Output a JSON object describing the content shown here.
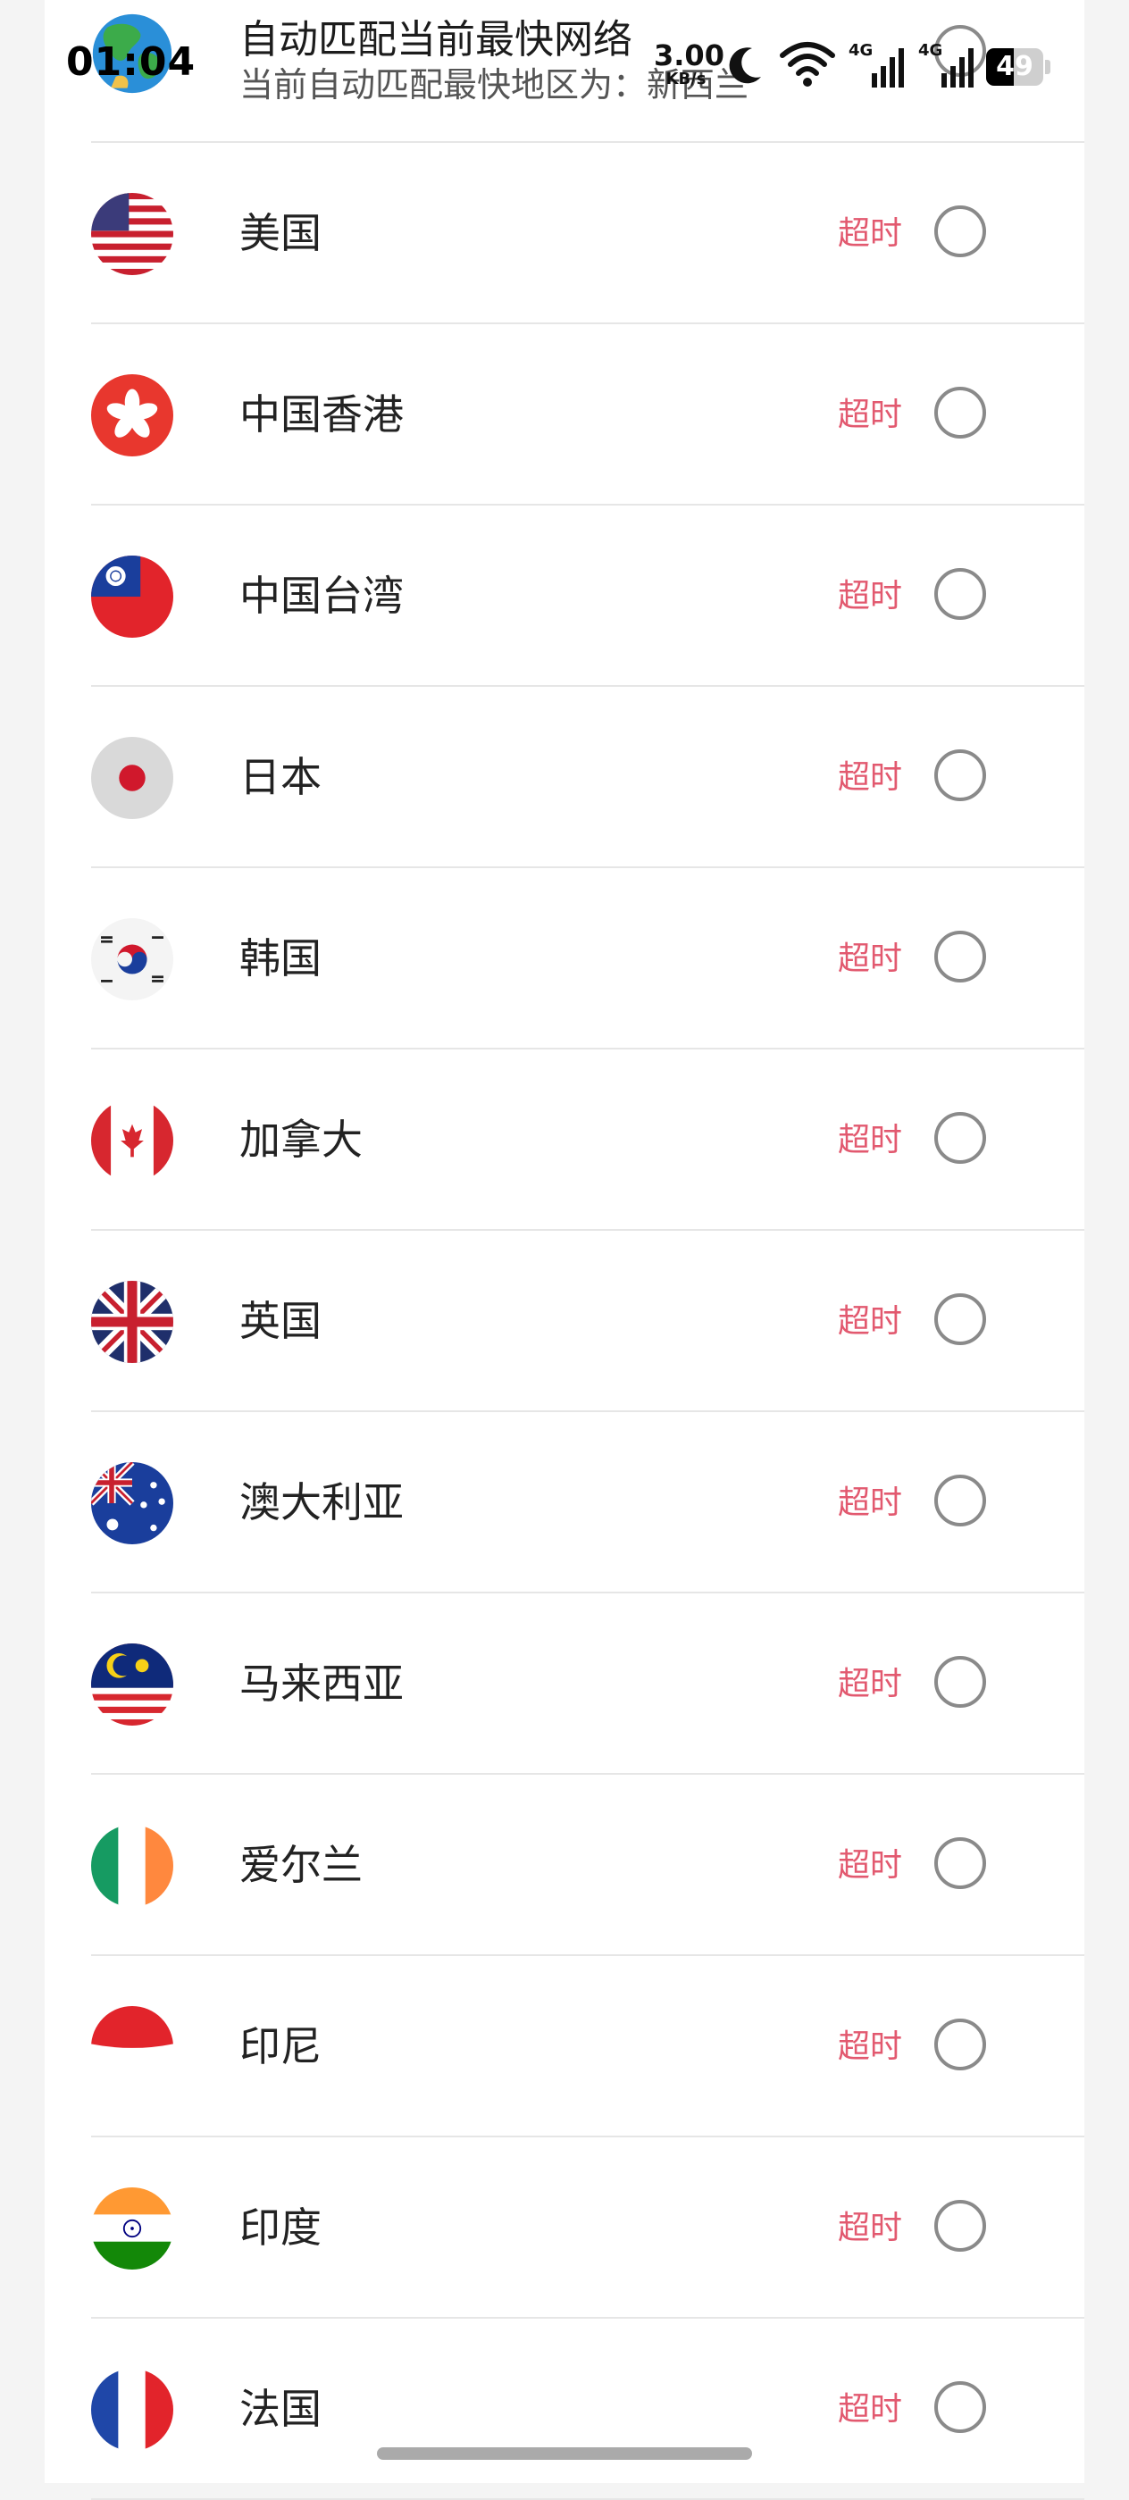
{
  "status_bar": {
    "time": "01:04",
    "net_speed_value": "3.00",
    "net_speed_unit": "KB/s",
    "network_1": "4G",
    "network_2": "4G",
    "battery_level": "49",
    "battery_fraction": 0.49
  },
  "auto_match": {
    "title": "自动匹配当前最快网络",
    "subtitle_prefix": "当前自动匹配最快地区为：",
    "subtitle_region": "新西兰"
  },
  "status_color": "#e2596f",
  "regions": [
    {
      "name": "美国",
      "status": "超时",
      "flag": "us-flag-icon"
    },
    {
      "name": "中国香港",
      "status": "超时",
      "flag": "hk-flag-icon"
    },
    {
      "name": "中国台湾",
      "status": "超时",
      "flag": "tw-flag-icon"
    },
    {
      "name": "日本",
      "status": "超时",
      "flag": "jp-flag-icon"
    },
    {
      "name": "韩国",
      "status": "超时",
      "flag": "kr-flag-icon"
    },
    {
      "name": "加拿大",
      "status": "超时",
      "flag": "ca-flag-icon"
    },
    {
      "name": "英国",
      "status": "超时",
      "flag": "uk-flag-icon"
    },
    {
      "name": "澳大利亚",
      "status": "超时",
      "flag": "au-flag-icon"
    },
    {
      "name": "马来西亚",
      "status": "超时",
      "flag": "my-flag-icon"
    },
    {
      "name": "爱尔兰",
      "status": "超时",
      "flag": "ie-flag-icon"
    },
    {
      "name": "印尼",
      "status": "超时",
      "flag": "id-flag-icon"
    },
    {
      "name": "印度",
      "status": "超时",
      "flag": "in-flag-icon"
    },
    {
      "name": "法国",
      "status": "超时",
      "flag": "fr-flag-icon"
    }
  ]
}
